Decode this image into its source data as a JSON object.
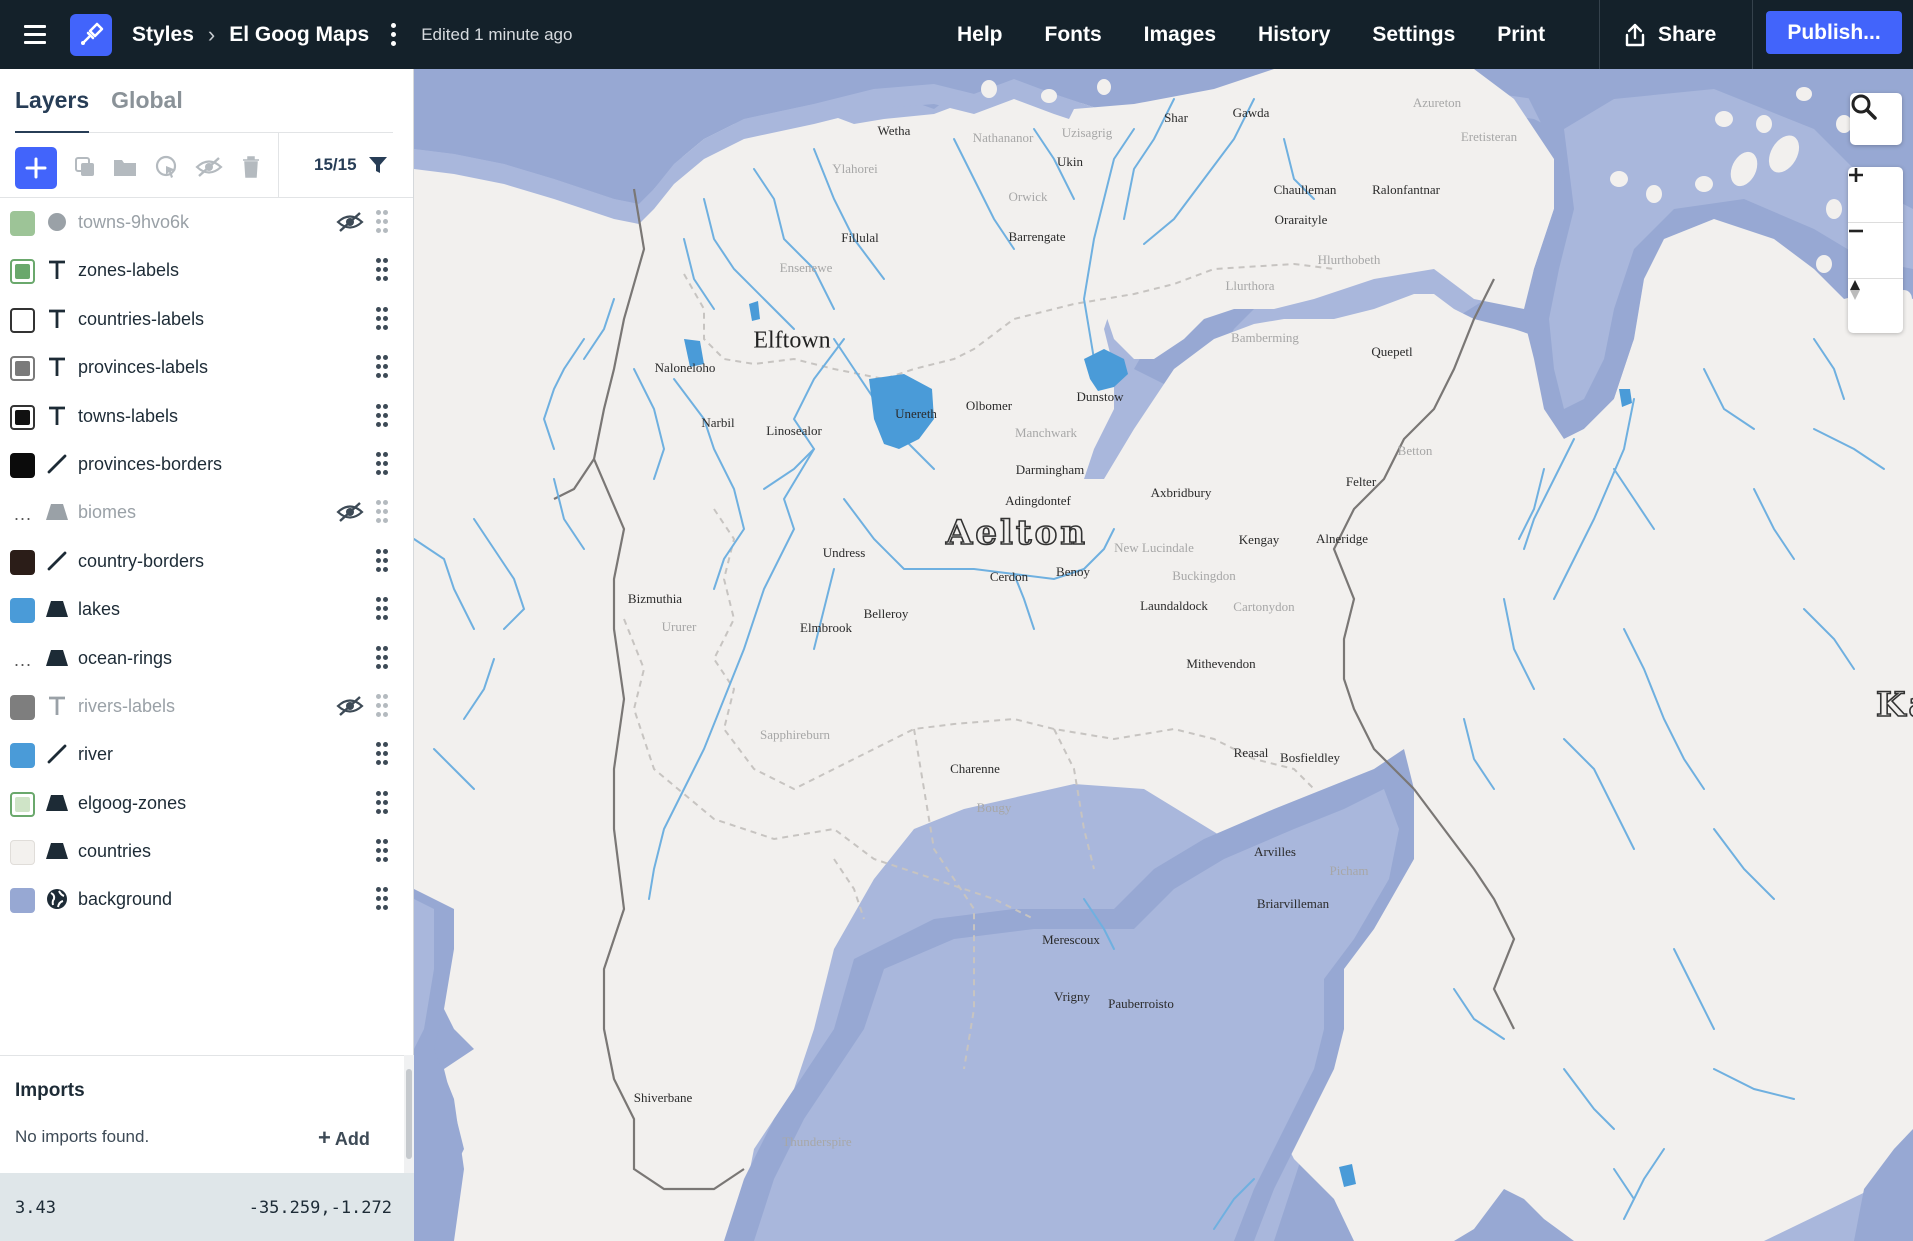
{
  "topbar": {
    "breadcrumb_root": "Styles",
    "style_name": "El Goog Maps",
    "edited": "Edited 1 minute ago",
    "nav": [
      "Help",
      "Fonts",
      "Images",
      "History",
      "Settings",
      "Print"
    ],
    "share": "Share",
    "publish": "Publish..."
  },
  "sidebar": {
    "tabs": [
      "Layers",
      "Global"
    ],
    "layer_count": "15/15",
    "layers": [
      {
        "name": "towns-9hvo6k",
        "type": "circle",
        "color": "#9dc497",
        "hidden": true
      },
      {
        "name": "zones-labels",
        "type": "symbol",
        "color": "#6aa86c",
        "hidden": false
      },
      {
        "name": "countries-labels",
        "type": "symbol",
        "color": "#ffffff",
        "hidden": false
      },
      {
        "name": "provinces-labels",
        "type": "symbol",
        "color": "#7a7a7a",
        "hidden": false
      },
      {
        "name": "towns-labels",
        "type": "symbol",
        "color": "#111111",
        "hidden": false
      },
      {
        "name": "provinces-borders",
        "type": "line",
        "color": "#0b0b0b",
        "hidden": false
      },
      {
        "name": "biomes",
        "type": "fill",
        "color": "multiple",
        "hidden": true
      },
      {
        "name": "country-borders",
        "type": "line",
        "color": "#2b1d18",
        "hidden": false
      },
      {
        "name": "lakes",
        "type": "fill",
        "color": "#4a9bd8",
        "hidden": false
      },
      {
        "name": "ocean-rings",
        "type": "fill",
        "color": "multiple",
        "hidden": false
      },
      {
        "name": "rivers-labels",
        "type": "symbol",
        "color": "#7e7e7e",
        "hidden": true
      },
      {
        "name": "river",
        "type": "line",
        "color": "#4a9bd8",
        "hidden": false
      },
      {
        "name": "elgoog-zones",
        "type": "fill",
        "color": "#cfe4c7",
        "hidden": false
      },
      {
        "name": "countries",
        "type": "fill",
        "color": "#f3f1ee",
        "hidden": false
      },
      {
        "name": "background",
        "type": "background",
        "color": "#97a8d3",
        "hidden": false
      }
    ],
    "imports": {
      "title": "Imports",
      "empty": "No imports found.",
      "add": "Add"
    },
    "status": {
      "zoom": "3.43",
      "coords": "-35.259,-1.272"
    }
  },
  "map": {
    "colors": {
      "ocean": "#97a8d3",
      "ocean_ring": "#a9b7dc",
      "land": "#f2f0ee",
      "lake": "#4a9bd8",
      "river": "#6fb0e0",
      "border": "#7a7775"
    },
    "labels": {
      "elftown": "Elftown",
      "aelton": "Aelton",
      "karnimrast": "Karnimrast",
      "wetha": "Wetha",
      "nathananor": "Nathananor",
      "uzisagrig": "Uzisagrig",
      "shar": "Shar",
      "gawda": "Gawda",
      "azureton": "Azureton",
      "eretisteran": "Eretisteran",
      "ylahorei": "Ylahorei",
      "ukin": "Ukin",
      "chaulleman": "Chaulleman",
      "ralonfantnar": "Ralonfantnar",
      "orwick": "Orwick",
      "oraraityle": "Oraraityle",
      "fillulal": "Fillulal",
      "barrengate": "Barrengate",
      "hlurthobeth": "Hlurthobeth",
      "ensenewe": "Ensenewe",
      "llurthora": "Llurthora",
      "bamberming": "Bamberming",
      "quepetl": "Quepetl",
      "naloneloho": "Naloneloho",
      "dunstow": "Dunstow",
      "olbomer": "Olbomer",
      "unereth": "Unereth",
      "narbil": "Narbil",
      "linosealor": "Linosealor",
      "manchwark": "Manchwark",
      "betton": "Betton",
      "darmingham": "Darmingham",
      "felter": "Felter",
      "axbridbury": "Axbridbury",
      "adingdontef": "Adingdontef",
      "kengay": "Kengay",
      "alneridge": "Alneridge",
      "new_lucindale": "New Lucindale",
      "undress": "Undress",
      "buckingdon": "Buckingdon",
      "benoy": "Benoy",
      "cerdon": "Cerdon",
      "bizmuthia": "Bizmuthia",
      "laundaldock": "Laundaldock",
      "cartonydon": "Cartonydon",
      "belleroy": "Belleroy",
      "ururer": "Ururer",
      "elmbrook": "Elmbrook",
      "mithevendon": "Mithevendon",
      "sapphireburn": "Sapphireburn",
      "reasal": "Reasal",
      "bosfieldley": "Bosfieldley",
      "charenne": "Charenne",
      "bougy": "Bougy",
      "arvilles": "Arvilles",
      "picham": "Picham",
      "briarvilleman": "Briarvilleman",
      "merescoux": "Merescoux",
      "vrigny": "Vrigny",
      "pauberroisto": "Pauberroisto",
      "shiverbane": "Shiverbane",
      "thunderspire": "Thunderspire"
    }
  }
}
